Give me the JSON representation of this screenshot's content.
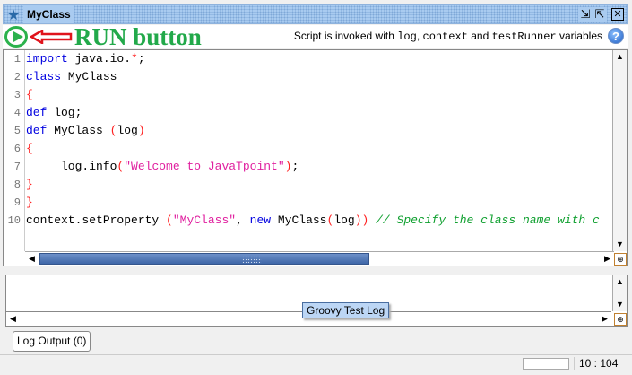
{
  "window": {
    "title": "MyClass",
    "icon": "star-icon"
  },
  "toolbar": {
    "run_annotation": "RUN button",
    "hint_prefix": "Script is invoked with ",
    "hint_log": "log",
    "hint_sep1": ", ",
    "hint_context": "context",
    "hint_sep2": " and ",
    "hint_runner": "testRunner",
    "hint_suffix": " variables",
    "help": "?"
  },
  "editor": {
    "line_numbers": [
      "1",
      "2",
      "3",
      "4",
      "5",
      "6",
      "7",
      "8",
      "9",
      "10"
    ],
    "lines": [
      [
        {
          "t": "import",
          "c": "kw"
        },
        {
          "t": " java.io.",
          "c": ""
        },
        {
          "t": "*",
          "c": "br"
        },
        {
          "t": ";",
          "c": ""
        }
      ],
      [
        {
          "t": "class",
          "c": "kw"
        },
        {
          "t": " MyClass",
          "c": ""
        }
      ],
      [
        {
          "t": "{",
          "c": "br"
        }
      ],
      [
        {
          "t": "def",
          "c": "kw"
        },
        {
          "t": " log;",
          "c": ""
        }
      ],
      [
        {
          "t": "def",
          "c": "kw"
        },
        {
          "t": " MyClass ",
          "c": ""
        },
        {
          "t": "(",
          "c": "br"
        },
        {
          "t": "log",
          "c": ""
        },
        {
          "t": ")",
          "c": "br"
        }
      ],
      [
        {
          "t": "{",
          "c": "br"
        }
      ],
      [
        {
          "t": "     log.info",
          "c": ""
        },
        {
          "t": "(",
          "c": "br"
        },
        {
          "t": "\"Welcome to JavaTpoint\"",
          "c": "st"
        },
        {
          "t": ")",
          "c": "br"
        },
        {
          "t": ";",
          "c": ""
        }
      ],
      [
        {
          "t": "}",
          "c": "br"
        }
      ],
      [
        {
          "t": "}",
          "c": "br"
        }
      ],
      [
        {
          "t": "context.setProperty ",
          "c": ""
        },
        {
          "t": "(",
          "c": "br"
        },
        {
          "t": "\"MyClass\"",
          "c": "st"
        },
        {
          "t": ", ",
          "c": ""
        },
        {
          "t": "new",
          "c": "kw"
        },
        {
          "t": " MyClass",
          "c": ""
        },
        {
          "t": "(",
          "c": "br"
        },
        {
          "t": "log",
          "c": ""
        },
        {
          "t": "))",
          "c": "br"
        },
        {
          "t": " // Specify the class name with c",
          "c": "cm"
        }
      ]
    ]
  },
  "log_panel": {
    "tooltip": "Groovy Test Log"
  },
  "log_output_button": "Log Output (0)",
  "status": {
    "cursor_position": "10 : 104"
  }
}
